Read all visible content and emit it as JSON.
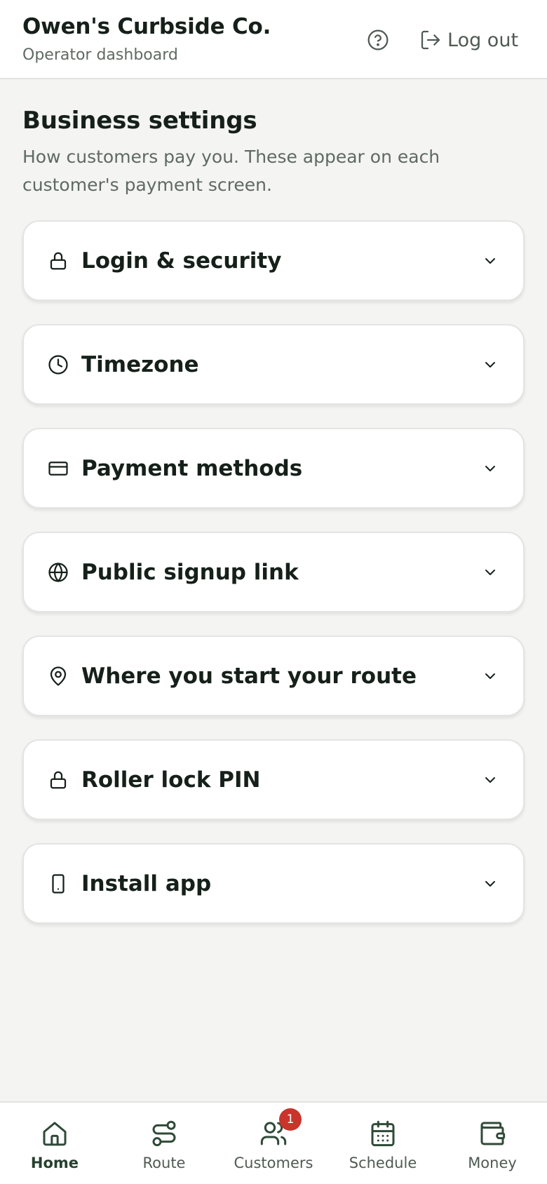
{
  "header": {
    "business_name": "Owen's Curbside Co.",
    "subtitle": "Operator dashboard",
    "help_icon": "help-circle-icon",
    "logout_label": "Log out"
  },
  "settings": {
    "title": "Business settings",
    "description": "How customers pay you. These appear on each customer's payment screen.",
    "sections": [
      {
        "label": "Login & security",
        "icon": "lock-icon"
      },
      {
        "label": "Timezone",
        "icon": "clock-icon"
      },
      {
        "label": "Payment methods",
        "icon": "credit-card-icon"
      },
      {
        "label": "Public signup link",
        "icon": "globe-icon"
      },
      {
        "label": "Where you start your route",
        "icon": "map-pin-icon"
      },
      {
        "label": "Roller lock PIN",
        "icon": "lock-icon"
      },
      {
        "label": "Install app",
        "icon": "smartphone-icon"
      }
    ]
  },
  "bottom_nav": {
    "items": [
      {
        "label": "Home",
        "icon": "home-icon"
      },
      {
        "label": "Route",
        "icon": "route-icon"
      },
      {
        "label": "Customers",
        "icon": "users-icon",
        "badge": "1"
      },
      {
        "label": "Schedule",
        "icon": "calendar-icon"
      },
      {
        "label": "Money",
        "icon": "wallet-icon"
      }
    ]
  },
  "colors": {
    "primary_text": "#16201a",
    "muted_text": "#5e6a62",
    "nav_icon": "#2f4a38",
    "badge": "#c9342b",
    "background": "#f4f4f2"
  }
}
